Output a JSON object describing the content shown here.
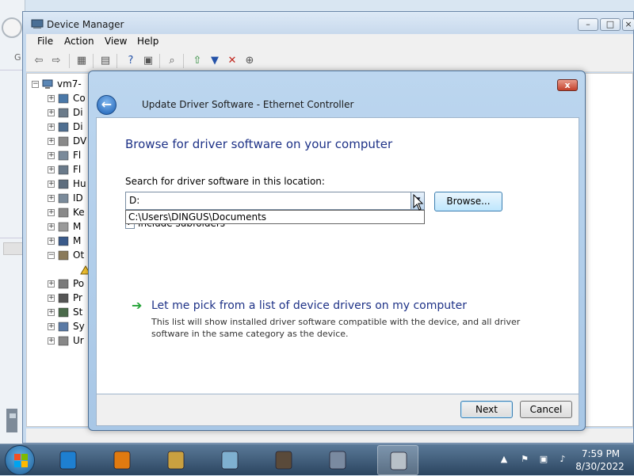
{
  "device_manager": {
    "title": "Device Manager",
    "menu": [
      "File",
      "Action",
      "View",
      "Help"
    ],
    "tree": {
      "root": "vm7-",
      "items": [
        {
          "label": "Co",
          "icon": "computer-icon",
          "expander": "+"
        },
        {
          "label": "Di",
          "icon": "disk-drive-icon",
          "expander": "+"
        },
        {
          "label": "Di",
          "icon": "display-adapter-icon",
          "expander": "+"
        },
        {
          "label": "DV",
          "icon": "dvd-drive-icon",
          "expander": "+"
        },
        {
          "label": "Fl",
          "icon": "floppy-controller-icon",
          "expander": "+"
        },
        {
          "label": "Fl",
          "icon": "floppy-drive-icon",
          "expander": "+"
        },
        {
          "label": "Hu",
          "icon": "human-interface-icon",
          "expander": "+"
        },
        {
          "label": "ID",
          "icon": "ide-controller-icon",
          "expander": "+"
        },
        {
          "label": "Ke",
          "icon": "keyboard-icon",
          "expander": "+"
        },
        {
          "label": "M",
          "icon": "mouse-icon",
          "expander": "+"
        },
        {
          "label": "M",
          "icon": "monitor-icon",
          "expander": "+"
        },
        {
          "label": "Ot",
          "icon": "other-devices-icon",
          "expander": "-"
        },
        {
          "label": "",
          "icon": "warning-device-icon",
          "expander": ""
        },
        {
          "label": "Po",
          "icon": "ports-icon",
          "expander": "+"
        },
        {
          "label": "Pr",
          "icon": "processor-icon",
          "expander": "+"
        },
        {
          "label": "St",
          "icon": "storage-icon",
          "expander": "+"
        },
        {
          "label": "Sy",
          "icon": "system-devices-icon",
          "expander": "+"
        },
        {
          "label": "Ur",
          "icon": "usb-icon",
          "expander": "+"
        }
      ]
    }
  },
  "dialog": {
    "title": "Update Driver Software - Ethernet Controller",
    "heading": "Browse for driver software on your computer",
    "search_label": "Search for driver software in this location:",
    "path_value": "D:",
    "autocomplete_item": "C:\\Users\\DINGUS\\Documents",
    "include_subfolders_label": "Include subfolders",
    "include_subfolders_checked": true,
    "browse_label": "Browse...",
    "pick_title": "Let me pick from a list of device drivers on my computer",
    "pick_desc": "This list will show installed driver software compatible with the device, and all driver software in the same category as the device.",
    "next_label": "Next",
    "cancel_label": "Cancel",
    "close_label": "x"
  },
  "taskbar": {
    "apps": [
      {
        "name": "internet-explorer-icon",
        "active": false
      },
      {
        "name": "media-player-icon",
        "active": false
      },
      {
        "name": "files-icon",
        "active": false
      },
      {
        "name": "notepad-icon",
        "active": false
      },
      {
        "name": "raccoon-app-icon",
        "active": false
      },
      {
        "name": "control-panel-icon",
        "active": false
      },
      {
        "name": "device-manager-icon",
        "active": true
      }
    ],
    "clock_time": "7:59 PM",
    "clock_date": "8/30/2022"
  },
  "colors": {
    "heading": "#1e3287",
    "taskbar": "#2b4560",
    "link_arrow": "#27a43a"
  }
}
